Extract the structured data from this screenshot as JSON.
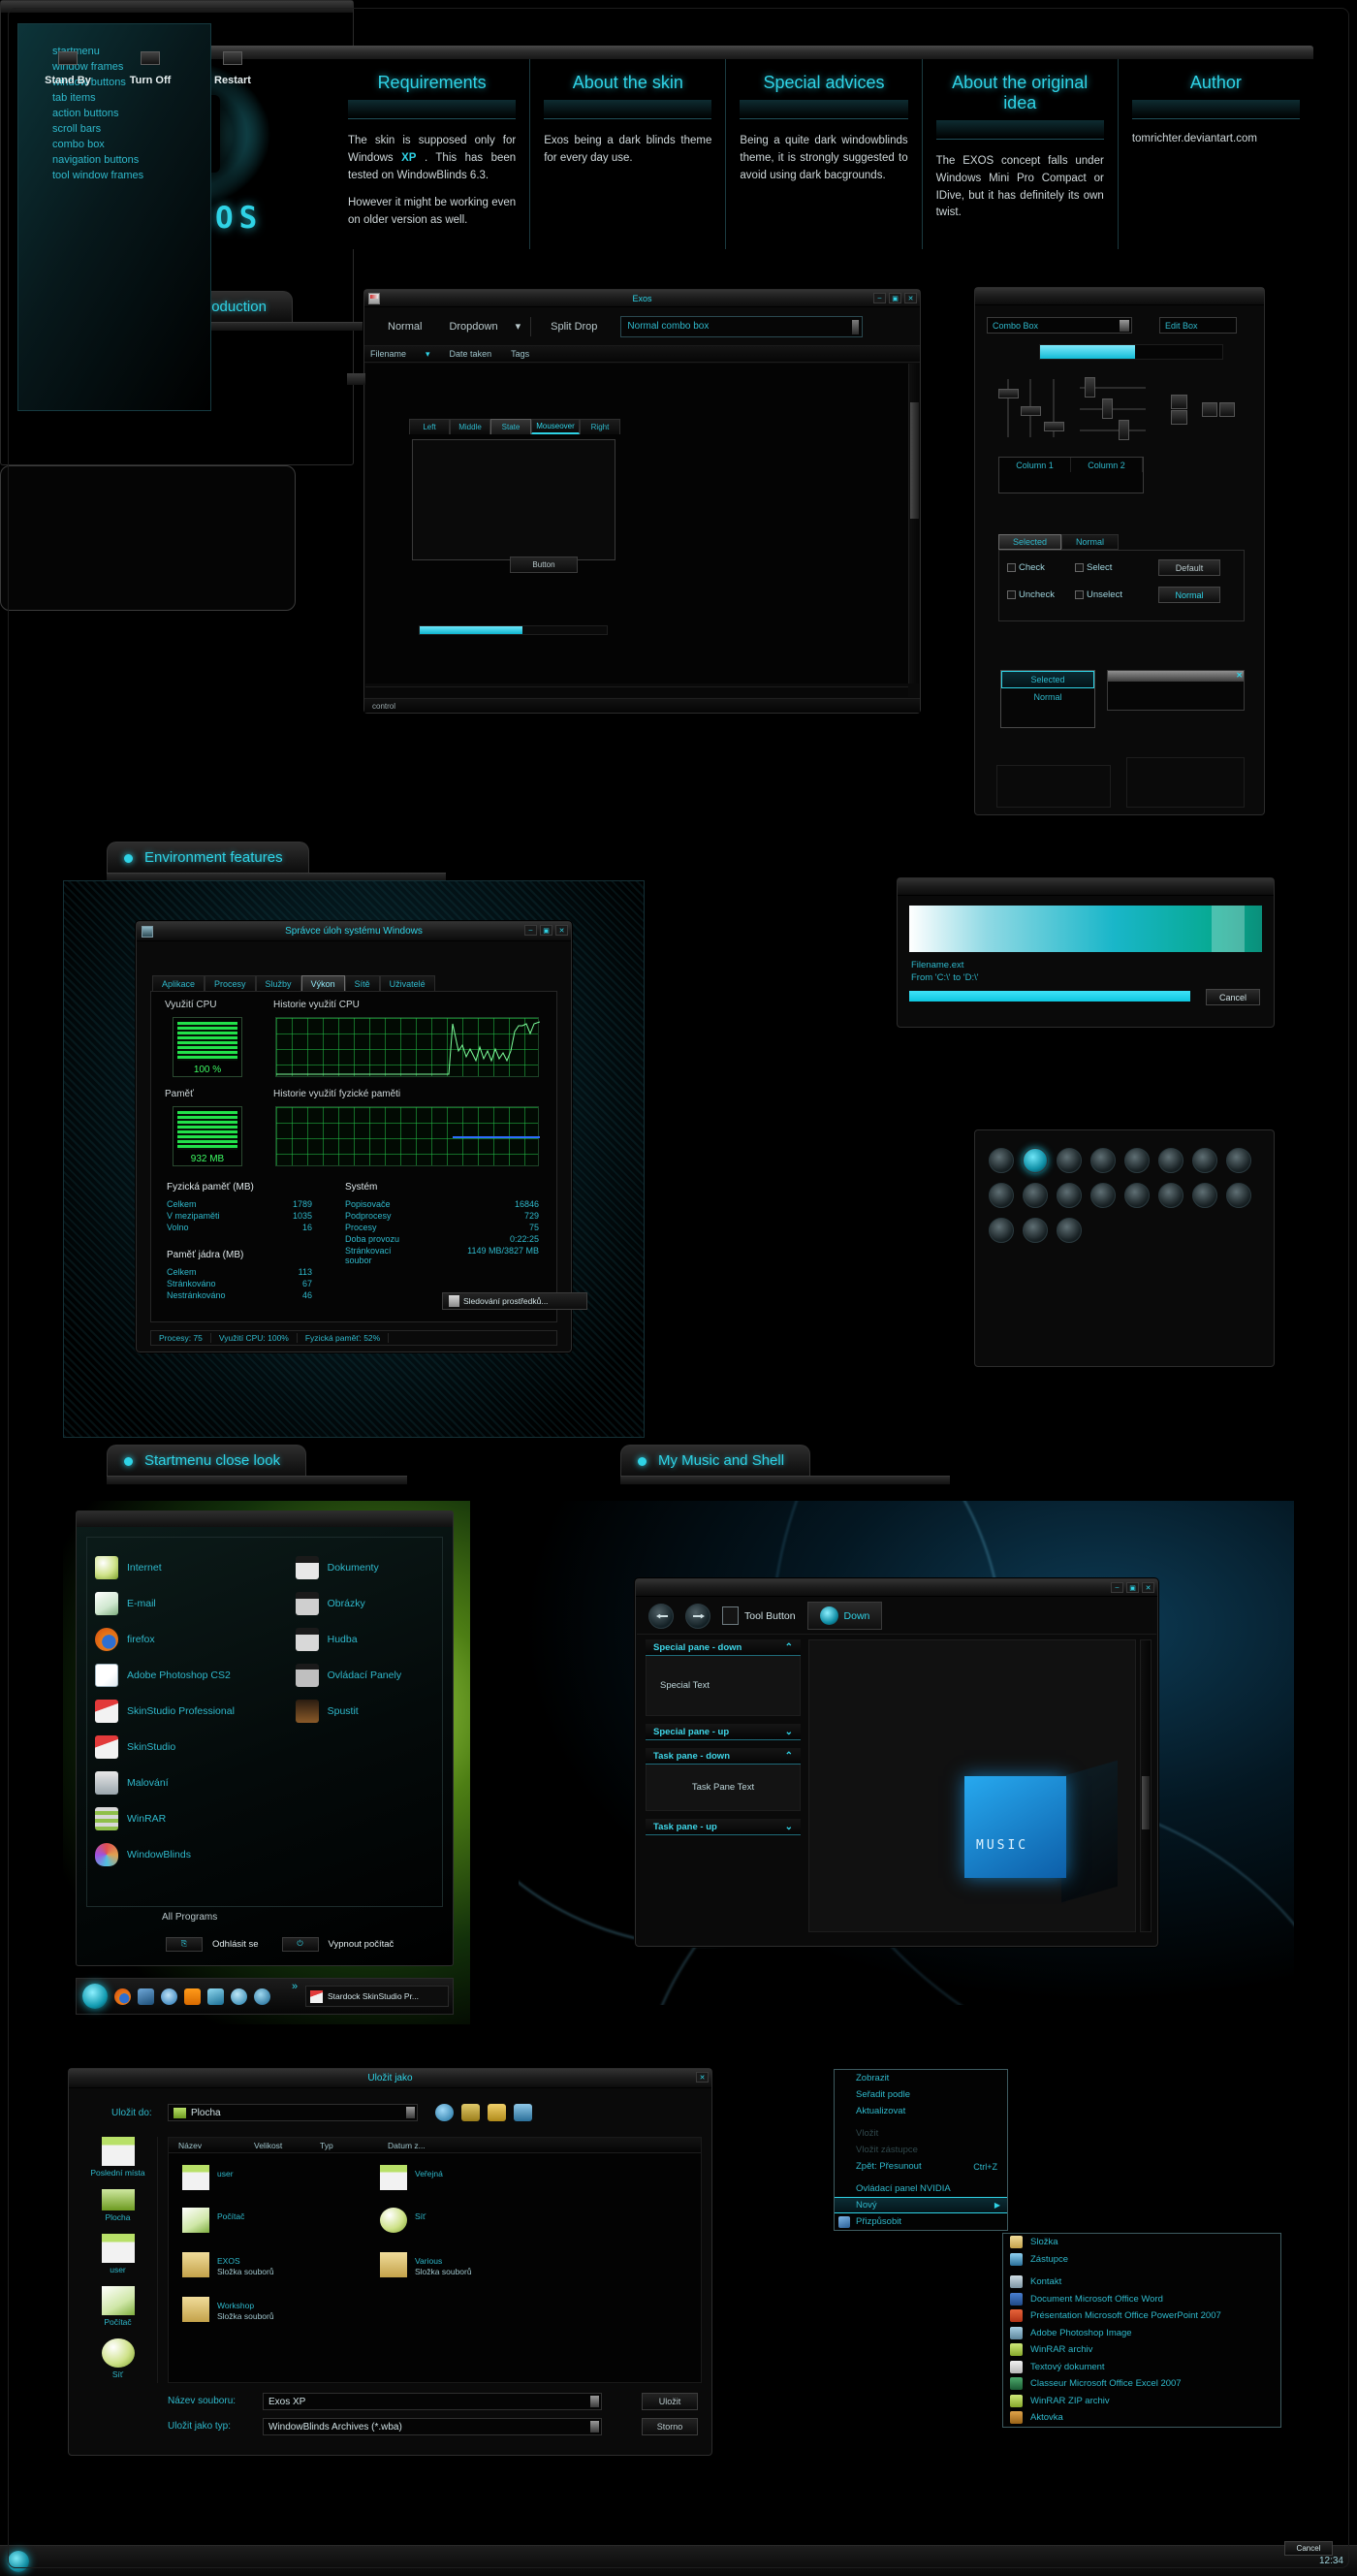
{
  "brand": {
    "name": "EXOS",
    "logo_icon": "exos-square-glyph"
  },
  "header": {
    "columns": [
      {
        "title": "Requirements",
        "paragraphs": [
          "The skin is supposed only for Windows XP . This has been tested on WindowBlinds 6.3.",
          "However it might be working even on older version as well."
        ],
        "highlight": "XP"
      },
      {
        "title": "About the skin",
        "paragraphs": [
          "Exos being a dark blinds theme for every day use."
        ]
      },
      {
        "title": "Special advices",
        "paragraphs": [
          "Being a quite dark windowblinds theme, it is strongly suggested to avoid using dark bacgrounds."
        ]
      },
      {
        "title": "About the original idea",
        "paragraphs": [
          "The EXOS concept falls under Windows Mini Pro Compact or IDive, but it has definitely its own twist."
        ]
      },
      {
        "title": "Author",
        "paragraphs": [
          "tomrichter.deviantart.com"
        ]
      }
    ]
  },
  "sections": {
    "interface": "Interface Introduction",
    "environment": "Environment features",
    "startmenu": "Startmenu close look",
    "music": "My Music and Shell"
  },
  "interface": {
    "list": [
      "startmenu",
      "window frames",
      "window buttons",
      "tab items",
      "action buttons",
      "scroll bars",
      "combo box",
      "navigation buttons",
      "tool window frames"
    ],
    "clock": "12:34",
    "demo_window": {
      "title": "Exos",
      "toolbar": {
        "normal": "Normal",
        "dropdown": "Dropdown",
        "dropdown_arrow": "▾",
        "split_drop": "Split Drop",
        "combo_value": "Normal combo box"
      },
      "columns": [
        "Filename",
        "Date taken",
        "Tags"
      ],
      "tabs": [
        "Left",
        "Middle",
        "State",
        "Mouseover",
        "Right"
      ],
      "selected_tab": "State",
      "mouseover_tab": "Mouseover",
      "button": "Button",
      "progress_percent": 55,
      "status": "control",
      "win_buttons": [
        "–",
        "▣",
        "✕"
      ]
    },
    "controls": {
      "combo_box": "Combo Box",
      "edit_box": "Edit Box",
      "progress_percent": 52,
      "list_columns": [
        "Column 1",
        "Column 2"
      ],
      "tabs": [
        "Selected",
        "Normal"
      ],
      "selected_tab": "Selected",
      "checks": [
        "Check",
        "Select",
        "Uncheck",
        "Unselect"
      ],
      "buttons": [
        "Default",
        "Normal"
      ],
      "listbox": [
        "Selected",
        "Normal"
      ],
      "listbox_selected": "Selected",
      "tool_close_icon": "✕"
    }
  },
  "taskmanager": {
    "title": "Správce úloh systému Windows",
    "tabs": [
      "Aplikace",
      "Procesy",
      "Služby",
      "Výkon",
      "Sítě",
      "Uživatelé"
    ],
    "selected_tab": "Výkon",
    "cpu_label": "Využití CPU",
    "cpu_value": "100 %",
    "cpu_history_label": "Historie využití CPU",
    "mem_label": "Paměť",
    "mem_value": "932 MB",
    "mem_history_label": "Historie využití fyzické paměti",
    "physical": {
      "title": "Fyzická paměť (MB)",
      "rows": [
        {
          "k": "Celkem",
          "v": "1789"
        },
        {
          "k": "V mezipaměti",
          "v": "1035"
        },
        {
          "k": "Volno",
          "v": "16"
        }
      ]
    },
    "kernel": {
      "title": "Paměť jádra (MB)",
      "rows": [
        {
          "k": "Celkem",
          "v": "113"
        },
        {
          "k": "Stránkováno",
          "v": "67"
        },
        {
          "k": "Nestránkováno",
          "v": "46"
        }
      ]
    },
    "system": {
      "title": "Systém",
      "rows": [
        {
          "k": "Popisovače",
          "v": "16846"
        },
        {
          "k": "Podprocesy",
          "v": "729"
        },
        {
          "k": "Procesy",
          "v": "75"
        },
        {
          "k": "Doba provozu",
          "v": "0:22:25"
        },
        {
          "k": "Stránkovací soubor",
          "v": "1149 MB/3827 MB"
        }
      ]
    },
    "resource_button": "Sledování prostředků...",
    "status": [
      "Procesy: 75",
      "Využití CPU: 100%",
      "Fyzická paměť: 52%"
    ]
  },
  "copy_dialog": {
    "filename": "Filename.ext",
    "path": "From 'C:\\' to 'D:\\'",
    "cancel": "Cancel",
    "progress_percent": 76
  },
  "shutdown_dialog": {
    "options": [
      "Stand By",
      "Turn Off",
      "Restart"
    ],
    "cancel": "Cancel"
  },
  "cursors": {
    "count": 19,
    "highlight_index": 1
  },
  "startmenu": {
    "left_items": [
      {
        "label": "Internet",
        "icon": "globe-icon"
      },
      {
        "label": "E-mail",
        "icon": "mail-cube-icon"
      },
      {
        "label": "firefox",
        "icon": "firefox-icon"
      },
      {
        "label": "Adobe Photoshop CS2",
        "icon": "photoshop-feather-icon"
      },
      {
        "label": "SkinStudio Professional",
        "icon": "skinstudio-icon"
      },
      {
        "label": "SkinStudio",
        "icon": "skinstudio-icon"
      },
      {
        "label": "Malování",
        "icon": "paint-cup-icon"
      },
      {
        "label": "WinRAR",
        "icon": "winrar-books-icon"
      },
      {
        "label": "WindowBlinds",
        "icon": "windowblinds-palette-icon"
      }
    ],
    "right_items": [
      {
        "label": "Dokumenty",
        "icon": "documents-icon"
      },
      {
        "label": "Obrázky",
        "icon": "pictures-camera-icon"
      },
      {
        "label": "Hudba",
        "icon": "music-icon"
      },
      {
        "label": "Ovládací Panely",
        "icon": "control-panel-icon"
      },
      {
        "label": "Spustit",
        "icon": "run-icon"
      }
    ],
    "all_programs": "All Programs",
    "logoff": "Odhlásit se",
    "shutdown": "Vypnout počítač",
    "taskbar_task": "Stardock SkinStudio Pr...",
    "taskbar_expand_icon": "»"
  },
  "shell": {
    "back_icon": "back-arrow-icon",
    "forward_icon": "forward-arrow-icon",
    "tool_button": "Tool Button",
    "down_button": "Down",
    "panes": [
      {
        "title": "Special pane - down",
        "chevron": "⌃",
        "body": "Special Text"
      },
      {
        "title": "Special pane - up",
        "chevron": "⌄",
        "body": null
      },
      {
        "title": "Task pane - down",
        "chevron": "⌃",
        "body": "Task Pane Text"
      },
      {
        "title": "Task pane - up",
        "chevron": "⌄",
        "body": null
      }
    ],
    "wallpaper_word": "MUSIC",
    "win_buttons": [
      "–",
      "▣",
      "✕"
    ]
  },
  "save_dialog": {
    "title": "Uložit jako",
    "save_in_label": "Uložit do:",
    "save_in_value": "Plocha",
    "toolbar_icons": [
      "globe-icon",
      "up-folder-icon",
      "new-folder-icon",
      "views-icon"
    ],
    "columns": [
      "Název",
      "Velikost",
      "Typ",
      "Datum z..."
    ],
    "places": [
      {
        "label": "Poslední místa",
        "icon": "recent-folder-icon"
      },
      {
        "label": "Plocha",
        "icon": "desktop-icon"
      },
      {
        "label": "user",
        "icon": "user-folder-icon"
      },
      {
        "label": "Počítač",
        "icon": "computer-icon"
      },
      {
        "label": "Síť",
        "icon": "network-globe-icon"
      }
    ],
    "items": [
      {
        "name": "user",
        "sub": "",
        "icon": "user-folder-icon"
      },
      {
        "name": "Veřejná",
        "sub": "",
        "icon": "public-folder-icon"
      },
      {
        "name": "Počítač",
        "sub": "",
        "icon": "computer-icon"
      },
      {
        "name": "Síť",
        "sub": "",
        "icon": "network-globe-icon"
      },
      {
        "name": "EXOS",
        "sub": "Složka souborů",
        "icon": "folder-icon"
      },
      {
        "name": "Various",
        "sub": "Složka souborů",
        "icon": "folder-icon"
      },
      {
        "name": "Workshop",
        "sub": "Složka souborů",
        "icon": "folder-icon"
      }
    ],
    "filename_label": "Název souboru:",
    "filename_value": "Exos XP",
    "filetype_label": "Uložit jako typ:",
    "filetype_value": "WindowBlinds Archives (*.wba)",
    "save_button": "Uložit",
    "cancel_button": "Storno"
  },
  "context_menu": {
    "items": [
      {
        "label": "Zobrazit",
        "dim": false,
        "arrow": false,
        "shortcut": ""
      },
      {
        "label": "Seřadit podle",
        "dim": false,
        "arrow": false,
        "shortcut": ""
      },
      {
        "label": "Aktualizovat",
        "dim": false,
        "arrow": false,
        "shortcut": ""
      },
      {
        "label": "__sep__",
        "dim": false,
        "arrow": false,
        "shortcut": ""
      },
      {
        "label": "Vložit",
        "dim": true,
        "arrow": false,
        "shortcut": ""
      },
      {
        "label": "Vložit zástupce",
        "dim": true,
        "arrow": false,
        "shortcut": ""
      },
      {
        "label": "Zpět: Přesunout",
        "dim": false,
        "arrow": false,
        "shortcut": "Ctrl+Z"
      },
      {
        "label": "__sep__",
        "dim": false,
        "arrow": false,
        "shortcut": ""
      },
      {
        "label": "Ovládací panel NVIDIA",
        "dim": false,
        "arrow": false,
        "shortcut": ""
      },
      {
        "label": "Nový",
        "dim": false,
        "arrow": true,
        "shortcut": "",
        "selected": true
      },
      {
        "label": "Přizpůsobit",
        "dim": false,
        "arrow": false,
        "shortcut": "",
        "icon": "personalize-icon"
      }
    ],
    "submenu": [
      {
        "label": "Složka",
        "icon": "folder-icon",
        "color": "#d8c26a"
      },
      {
        "label": "Zástupce",
        "icon": "shortcut-icon",
        "color": "#4aa8d8"
      },
      {
        "label": "__sep__",
        "icon": "",
        "color": ""
      },
      {
        "label": "Kontakt",
        "icon": "contact-icon",
        "color": "#9bb7c9"
      },
      {
        "label": "Document Microsoft Office Word",
        "icon": "word-icon",
        "color": "#2b5797"
      },
      {
        "label": "Présentation Microsoft Office PowerPoint 2007",
        "icon": "powerpoint-icon",
        "color": "#d24726"
      },
      {
        "label": "Adobe Photoshop Image",
        "icon": "photoshop-icon",
        "color": "#7fb7d8"
      },
      {
        "label": "WinRAR archiv",
        "icon": "winrar-icon",
        "color": "#b9d94a"
      },
      {
        "label": "Textový dokument",
        "icon": "text-icon",
        "color": "#d8d8d8"
      },
      {
        "label": "Classeur Microsoft Office Excel 2007",
        "icon": "excel-icon",
        "color": "#217346"
      },
      {
        "label": "WinRAR ZIP archiv",
        "icon": "winrar-zip-icon",
        "color": "#b9d94a"
      },
      {
        "label": "Aktovka",
        "icon": "briefcase-icon",
        "color": "#c98a3a"
      }
    ]
  },
  "colors": {
    "accent": "#2fd3e6",
    "accent_dim": "#2fb9cc",
    "bg": "#000000"
  }
}
